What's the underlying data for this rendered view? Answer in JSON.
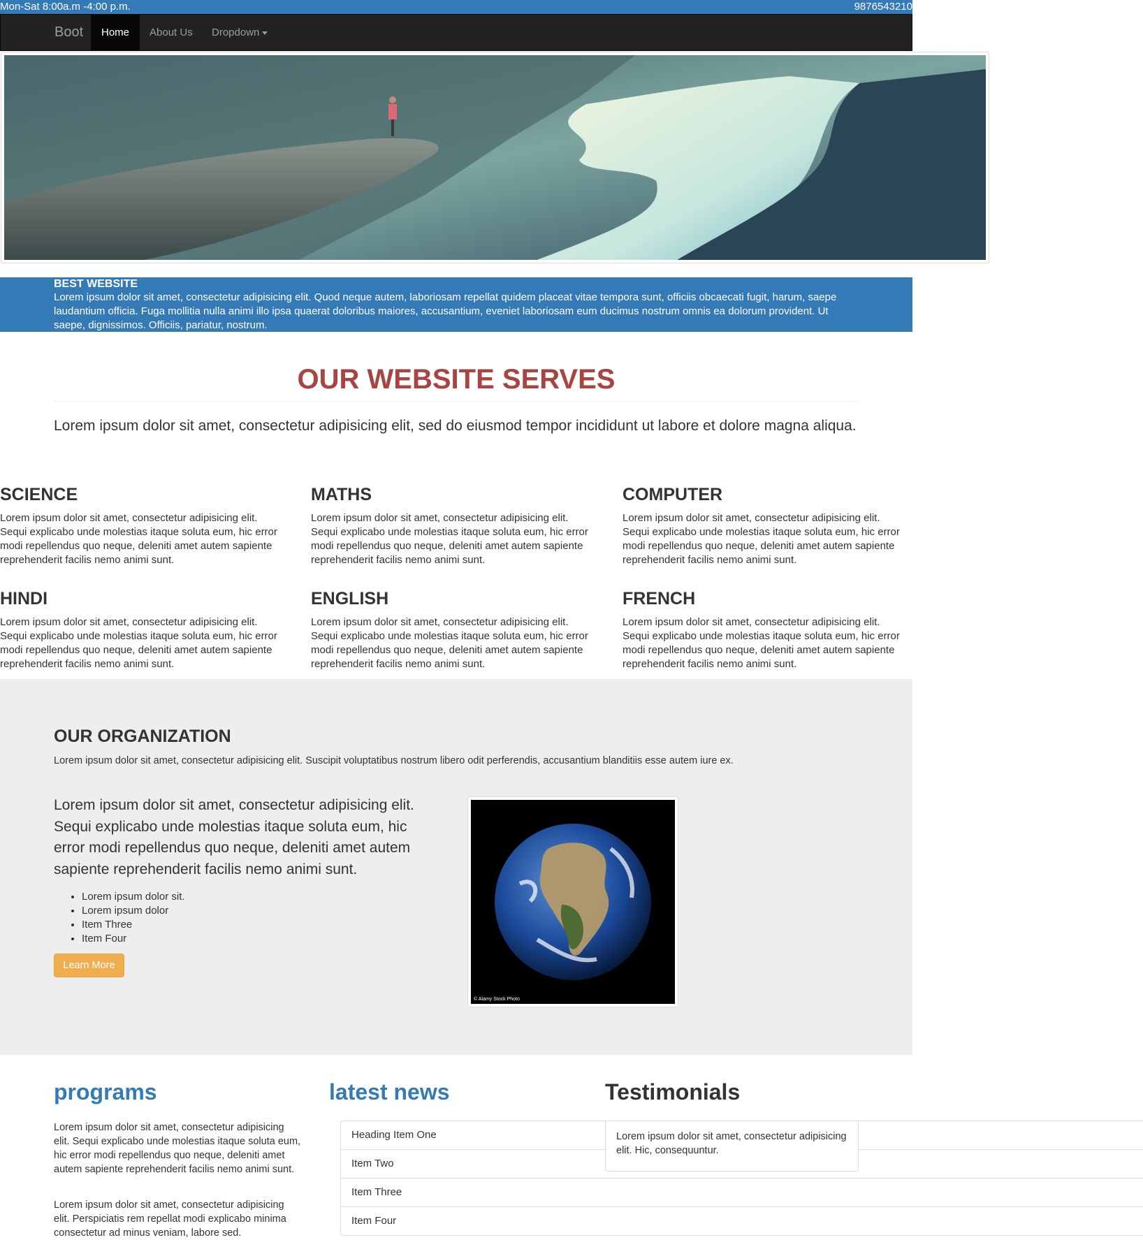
{
  "topbar": {
    "hours": "Mon-Sat 8:00a.m -4:00 p.m.",
    "phone": "9876543210"
  },
  "navbar": {
    "brand": "Boot",
    "items": [
      {
        "label": "Home",
        "active": true
      },
      {
        "label": "About Us"
      },
      {
        "label": "Dropdown"
      }
    ]
  },
  "band": {
    "title": "BEST WEBSITE",
    "text": "Lorem ipsum dolor sit amet, consectetur adipisicing elit. Quod neque autem, laboriosam repellat quidem placeat vitae tempora sunt, officiis obcaecati fugit, harum, saepe laudantium officia. Fuga mollitia nulla animi illo ipsa quaerat doloribus maiores, accusantium, eveniet laboriosam eum ducimus nostrum omnis ea dolorum provident. Ut saepe, dignissimos. Officiis, pariatur, nostrum."
  },
  "serves": {
    "title": "OUR WEBSITE SERVES",
    "lead": "Lorem ipsum dolor sit amet, consectetur adipisicing elit, sed do eiusmod tempor incididunt ut labore et dolore magna aliqua.",
    "subjects": [
      {
        "title": "SCIENCE",
        "text": "Lorem ipsum dolor sit amet, consectetur adipisicing elit. Sequi explicabo unde molestias itaque soluta eum, hic error modi repellendus quo neque, deleniti amet autem sapiente reprehenderit facilis nemo animi sunt."
      },
      {
        "title": "MATHS",
        "text": "Lorem ipsum dolor sit amet, consectetur adipisicing elit. Sequi explicabo unde molestias itaque soluta eum, hic error modi repellendus quo neque, deleniti amet autem sapiente reprehenderit facilis nemo animi sunt."
      },
      {
        "title": "COMPUTER",
        "text": "Lorem ipsum dolor sit amet, consectetur adipisicing elit. Sequi explicabo unde molestias itaque soluta eum, hic error modi repellendus quo neque, deleniti amet autem sapiente reprehenderit facilis nemo animi sunt."
      },
      {
        "title": "HINDI",
        "text": "Lorem ipsum dolor sit amet, consectetur adipisicing elit. Sequi explicabo unde molestias itaque soluta eum, hic error modi repellendus quo neque, deleniti amet autem sapiente reprehenderit facilis nemo animi sunt."
      },
      {
        "title": "ENGLISH",
        "text": "Lorem ipsum dolor sit amet, consectetur adipisicing elit. Sequi explicabo unde molestias itaque soluta eum, hic error modi repellendus quo neque, deleniti amet autem sapiente reprehenderit facilis nemo animi sunt."
      },
      {
        "title": "FRENCH",
        "text": "Lorem ipsum dolor sit amet, consectetur adipisicing elit. Sequi explicabo unde molestias itaque soluta eum, hic error modi repellendus quo neque, deleniti amet autem sapiente reprehenderit facilis nemo animi sunt."
      }
    ]
  },
  "org": {
    "title": "OUR ORGANIZATION",
    "subtitle": "Lorem ipsum dolor sit amet, consectetur adipisicing elit. Suscipit voluptatibus nostrum libero odit perferendis, accusantium blanditiis esse autem iure ex.",
    "lead": "Lorem ipsum dolor sit amet, consectetur adipisicing elit. Sequi explicabo unde molestias itaque soluta eum, hic error modi repellendus quo neque, deleniti amet autem sapiente reprehenderit facilis nemo animi sunt.",
    "list": [
      "Lorem ipsum dolor sit.",
      "Lorem ipsum dolor",
      "Item Three",
      "Item Four"
    ],
    "button": "Learn More",
    "image_caption": "© Alamy Stock Photo"
  },
  "programs": {
    "title": "programs",
    "p1": "Lorem ipsum dolor sit amet, consectetur adipisicing elit. Sequi explicabo unde molestias itaque soluta eum, hic error modi repellendus quo neque, deleniti amet autem sapiente reprehenderit facilis nemo animi sunt.",
    "p2": "Lorem ipsum dolor sit amet, consectetur adipisicing elit. Perspiciatis rem repellat modi explicabo minima consectetur ad minus veniam, labore sed."
  },
  "news": {
    "title": "latest news",
    "items": [
      "Heading Item One",
      "Item Two",
      "Item Three",
      "Item Four"
    ]
  },
  "testimonials": {
    "title": "Testimonials",
    "text": "Lorem ipsum dolor sit amet, consectetur adipisicing elit. Hic, consequuntur."
  },
  "colors": {
    "primary": "#337ab7",
    "danger": "#a94442",
    "warning": "#f0ad4e",
    "navbar": "#222222",
    "section_bg": "#eeeeee"
  }
}
